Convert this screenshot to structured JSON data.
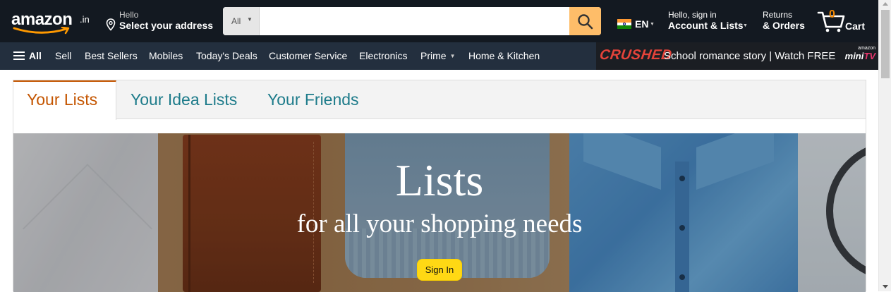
{
  "logo": {
    "word": "amazon",
    "tld": ".in"
  },
  "address": {
    "greeting": "Hello",
    "action": "Select your address"
  },
  "search": {
    "category": "All",
    "placeholder": "",
    "value": ""
  },
  "language": {
    "code": "EN"
  },
  "account": {
    "greeting": "Hello, sign in",
    "label": "Account & Lists"
  },
  "returns": {
    "line1": "Returns",
    "line2": "& Orders"
  },
  "cart": {
    "count": "0",
    "label": "Cart"
  },
  "subnav": {
    "all": "All",
    "items": [
      "Sell",
      "Best Sellers",
      "Mobiles",
      "Today's Deals",
      "Customer Service",
      "Electronics",
      "Prime",
      "Home & Kitchen"
    ]
  },
  "promo": {
    "brand": "CRUSHED",
    "text": "School romance story | Watch FREE",
    "mtv_top": "amazon",
    "mtv_mini": "mini",
    "mtv_tv": "TV"
  },
  "tabs": [
    "Your Lists",
    "Your Idea Lists",
    "Your Friends"
  ],
  "hero": {
    "title": "Lists",
    "subtitle": "for all your shopping needs",
    "button": "Sign In"
  },
  "colors": {
    "nav_dark": "#131921",
    "nav_secondary": "#232f3e",
    "search_button": "#febd69",
    "active_tab": "#c45500",
    "tab_link": "#1d7b8a",
    "cart_count": "#f08804",
    "signin_button": "#ffd814"
  },
  "icons": {
    "location": "location-pin-icon",
    "search": "search-icon",
    "cart": "cart-icon",
    "menu": "hamburger-menu-icon",
    "flag": "india-flag-icon"
  }
}
